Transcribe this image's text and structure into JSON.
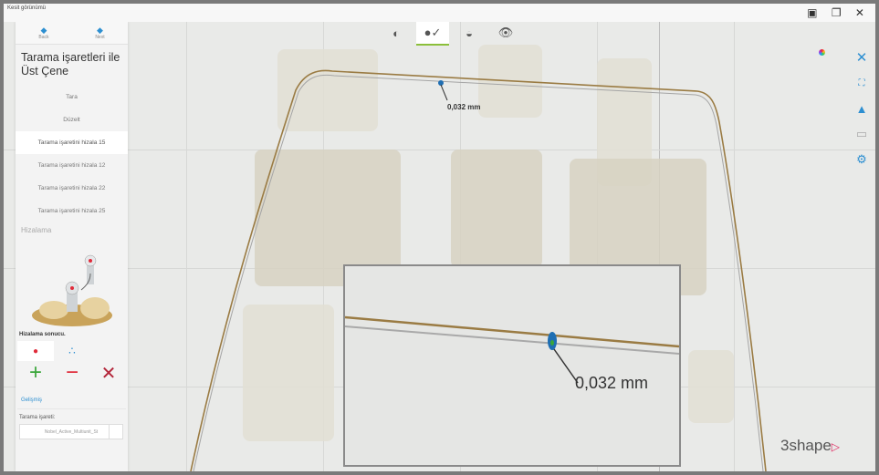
{
  "window": {
    "title": "Kesit görünümü",
    "controls": "▣ ❐ ✕"
  },
  "toolbar": {
    "items": [
      {
        "name": "jaw-scan-icon",
        "glyph": "◐"
      },
      {
        "name": "lower-jaw-icon",
        "glyph": "●✓"
      },
      {
        "name": "upper-jaw-icon",
        "glyph": "◒"
      },
      {
        "name": "eye-icon",
        "glyph": "👁"
      }
    ]
  },
  "nav": {
    "back": "Back",
    "next": "Next"
  },
  "panel": {
    "title": "Tarama işaretleri ile Üst Çene",
    "steps": [
      "Tara",
      "Düzelt",
      "Tarama işaretini hizala 15",
      "Tarama işaretini hizala 12",
      "Tarama işaretini hizala 22",
      "Tarama işaretini hizala 25"
    ],
    "current_step_index": 2,
    "section_label": "Hizalama",
    "result_label": "Hizalama sonucu.",
    "advanced": "Gelişmiş",
    "marker_label": "Tarama işareti:",
    "marker_value": "Nobel_Active_Multiunit_St"
  },
  "measure": {
    "small": "0,032 mm",
    "big": "0,032 mm"
  },
  "logo": {
    "text": "3shape",
    "mark": "▷"
  },
  "colors": {
    "accent": "#2d8fd1",
    "curve": "#9a7b43",
    "add": "#3aa63a",
    "remove": "#e02b3a",
    "close": "#b3263a"
  }
}
